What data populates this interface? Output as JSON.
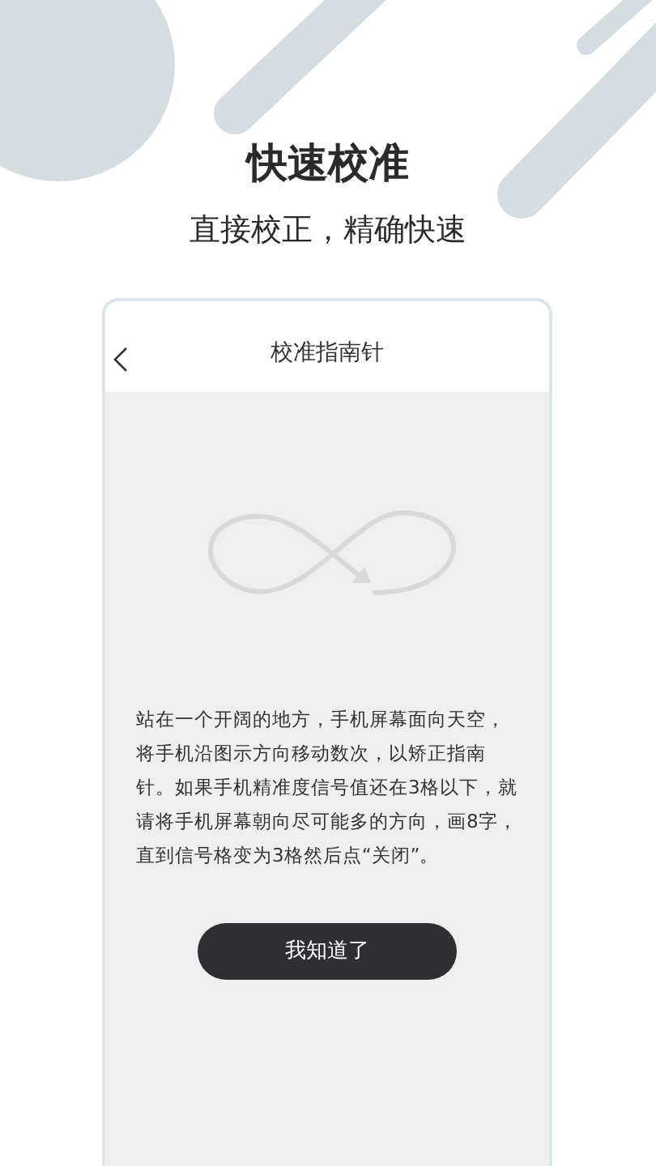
{
  "headline": "快速校准",
  "subheadline": "直接校正，精确快速",
  "phone": {
    "header": {
      "title": "校准指南针"
    },
    "instructions": "站在一个开阔的地方，手机屏幕面向天空，将手机沿图示方向移动数次，以矫正指南针。如果手机精准度信号值还在3格以下，就请将手机屏幕朝向尽可能多的方向，画8字，直到信号格变为3格然后点“关闭”。",
    "button": "我知道了"
  }
}
